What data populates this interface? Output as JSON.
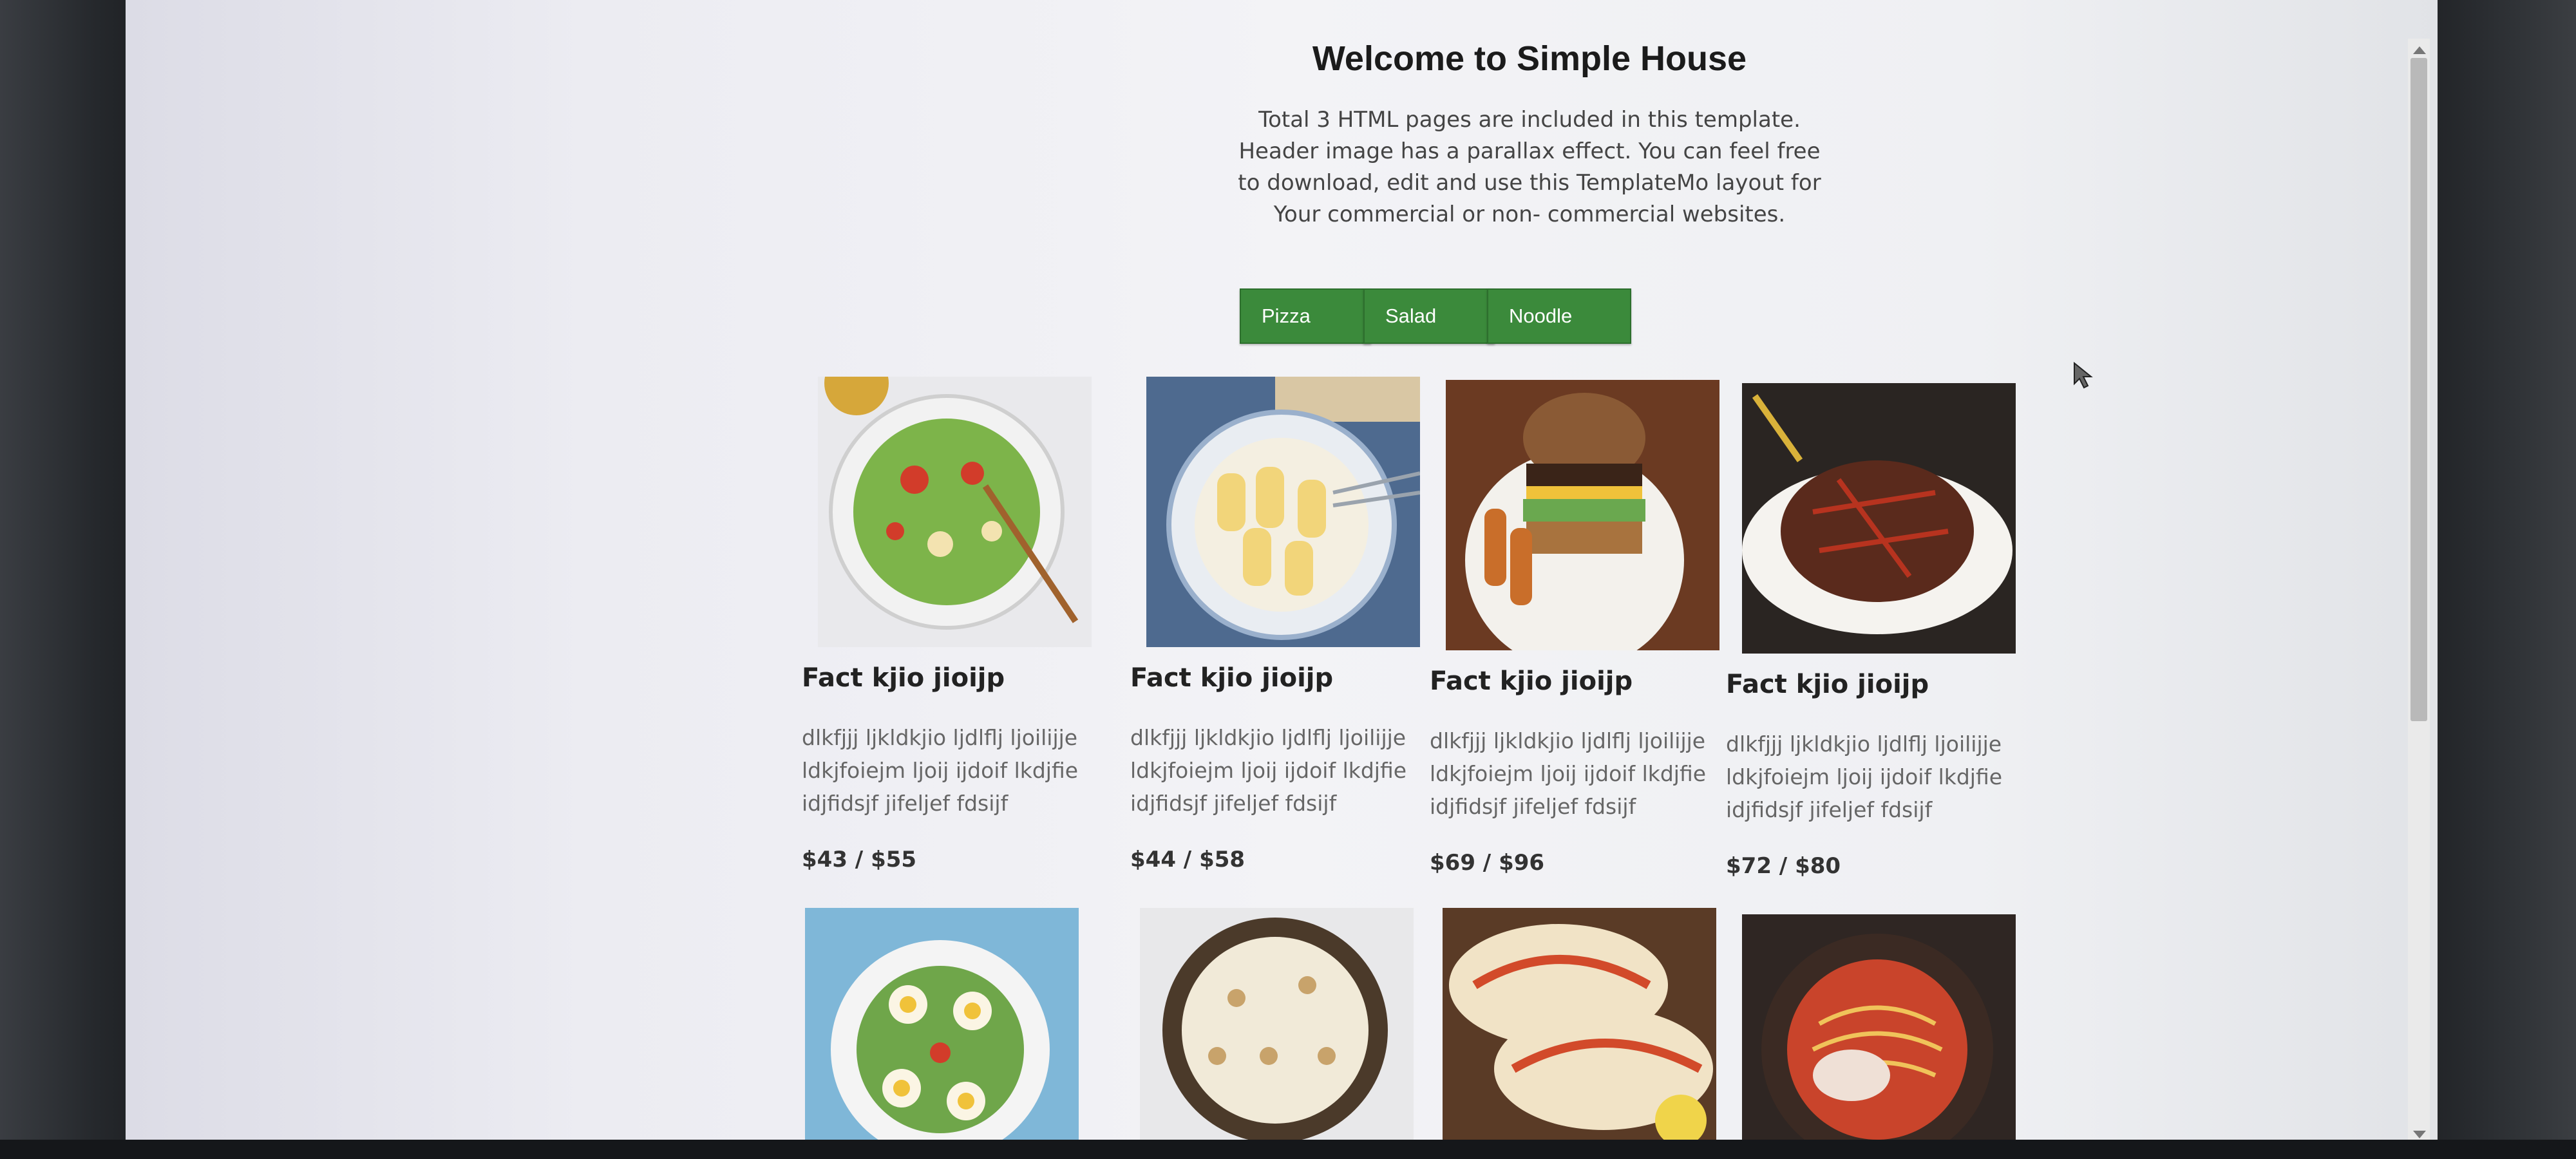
{
  "page": {
    "heading": "Welcome to Simple House",
    "intro": "Total 3 HTML pages are included in this template. Header image has a parallax effect. You can feel free to download, edit and use this TemplateMo layout for Your commercial or non- commercial websites."
  },
  "tabs": [
    {
      "label": "Pizza"
    },
    {
      "label": "Salad"
    },
    {
      "label": "Noodle"
    }
  ],
  "items": [
    {
      "title": "Fact kjio jioijp",
      "desc": "dlkfjjj ljkldkjio ljdlflj ljoilijje ldkjfoiejm ljoij ijdoif lkdjfie idjfidsjf jifeljef fdsijf",
      "price": "$43 / $55",
      "image_icon": "salad-bowl"
    },
    {
      "title": "Fact kjio jioijp",
      "desc": "dlkfjjj ljkldkjio ljdlflj ljoilijje ldkjfoiejm ljoij ijdoif lkdjfie idjfidsjf jifeljef fdsijf",
      "price": "$44 / $58",
      "image_icon": "pasta-plate"
    },
    {
      "title": "Fact kjio jioijp",
      "desc": "dlkfjjj ljkldkjio ljdlflj ljoilijje ldkjfoiejm ljoij ijdoif lkdjfie idjfidsjf jifeljef fdsijf",
      "price": "$69 / $96",
      "image_icon": "burger-plate"
    },
    {
      "title": "Fact kjio jioijp",
      "desc": "dlkfjjj ljkldkjio ljdlflj ljoilijje ldkjfoiejm ljoij ijdoif lkdjfie idjfidsjf jifeljef fdsijf",
      "price": "$72 / $80",
      "image_icon": "stir-fry-plate"
    },
    {
      "image_icon": "egg-salad-bowl"
    },
    {
      "image_icon": "rice-pudding-pan"
    },
    {
      "image_icon": "tacos-plate"
    },
    {
      "image_icon": "noodle-bowl"
    }
  ],
  "colors": {
    "accent": "#3b8a3b",
    "text": "#333333",
    "muted": "#666666"
  }
}
